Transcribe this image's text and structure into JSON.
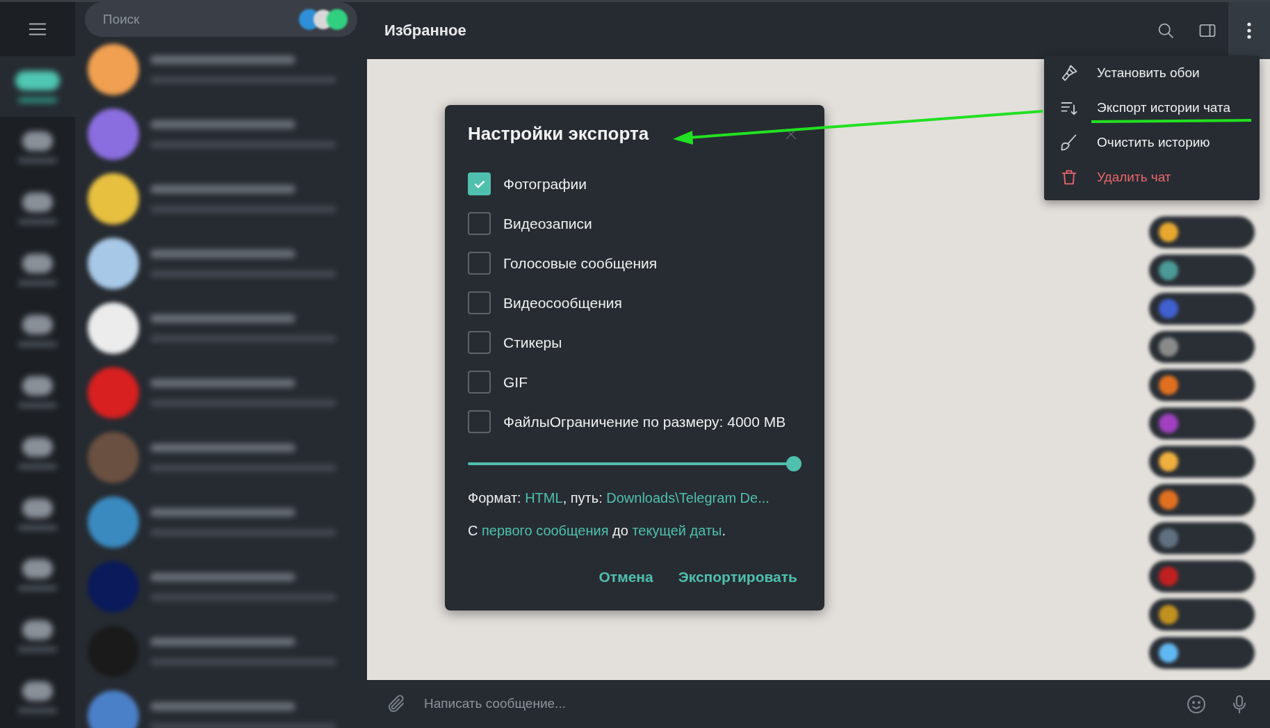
{
  "search": {
    "placeholder": "Поиск"
  },
  "folders": [
    {
      "selected": true
    },
    {
      "selected": false
    },
    {
      "selected": false
    },
    {
      "selected": false
    },
    {
      "selected": false
    },
    {
      "selected": false
    },
    {
      "selected": false
    },
    {
      "selected": false
    },
    {
      "selected": false
    },
    {
      "selected": false
    },
    {
      "selected": false
    }
  ],
  "chat_list": [
    {
      "color": "#f0a050"
    },
    {
      "color": "#8a6ee0"
    },
    {
      "color": "#e8c040"
    },
    {
      "color": "#a8c8e8"
    },
    {
      "color": "#ececec"
    },
    {
      "color": "#d82020"
    },
    {
      "color": "#6a5040"
    },
    {
      "color": "#3a8ac0"
    },
    {
      "color": "#0a1a5a"
    },
    {
      "color": "#1a1a1a"
    },
    {
      "color": "#4a80c8"
    }
  ],
  "header": {
    "title": "Избранное"
  },
  "messages": [
    {
      "color": "#e8a830"
    },
    {
      "color": "#4a9a98"
    },
    {
      "color": "#4060d0"
    },
    {
      "color": "#8a8a8a"
    },
    {
      "color": "#e07020"
    },
    {
      "color": "#a040c0"
    },
    {
      "color": "#f0b040"
    },
    {
      "color": "#e07020"
    },
    {
      "color": "#607080"
    },
    {
      "color": "#c02020"
    },
    {
      "color": "#c09020"
    },
    {
      "color": "#60b8f0"
    }
  ],
  "dialog": {
    "title": "Настройки экспорта",
    "options": [
      {
        "label": "Фотографии",
        "checked": true
      },
      {
        "label": "Видеозаписи",
        "checked": false
      },
      {
        "label": "Голосовые сообщения",
        "checked": false
      },
      {
        "label": "Видеосообщения",
        "checked": false
      },
      {
        "label": "Стикеры",
        "checked": false
      },
      {
        "label": "GIF",
        "checked": false
      },
      {
        "label": "ФайлыОграничение по размеру: 4000 MB",
        "checked": false
      }
    ],
    "size_slider": {
      "level": 1
    },
    "format_line": [
      {
        "kind": "text",
        "text": "Формат:"
      },
      {
        "kind": "link",
        "text": "HTML"
      },
      {
        "kind": "text",
        "text": ", путь:"
      },
      {
        "kind": "link",
        "text": "Downloads\\Telegram De..."
      }
    ],
    "range_line": [
      {
        "kind": "text",
        "text": "С"
      },
      {
        "kind": "link",
        "text": "первого сообщения"
      },
      {
        "kind": "text",
        "text": "до"
      },
      {
        "kind": "link",
        "text": "текущей даты"
      },
      {
        "kind": "text",
        "text": "."
      }
    ],
    "buttons": [
      "Отмена",
      "Экспортировать"
    ]
  },
  "menu": [
    {
      "label": "Установить обои",
      "danger": false
    },
    {
      "label": "Экспорт истории чата",
      "danger": false
    },
    {
      "label": "Очистить историю",
      "danger": false
    },
    {
      "label": "Удалить чат",
      "danger": true
    }
  ],
  "composer": {
    "placeholder": "Написать сообщение..."
  }
}
